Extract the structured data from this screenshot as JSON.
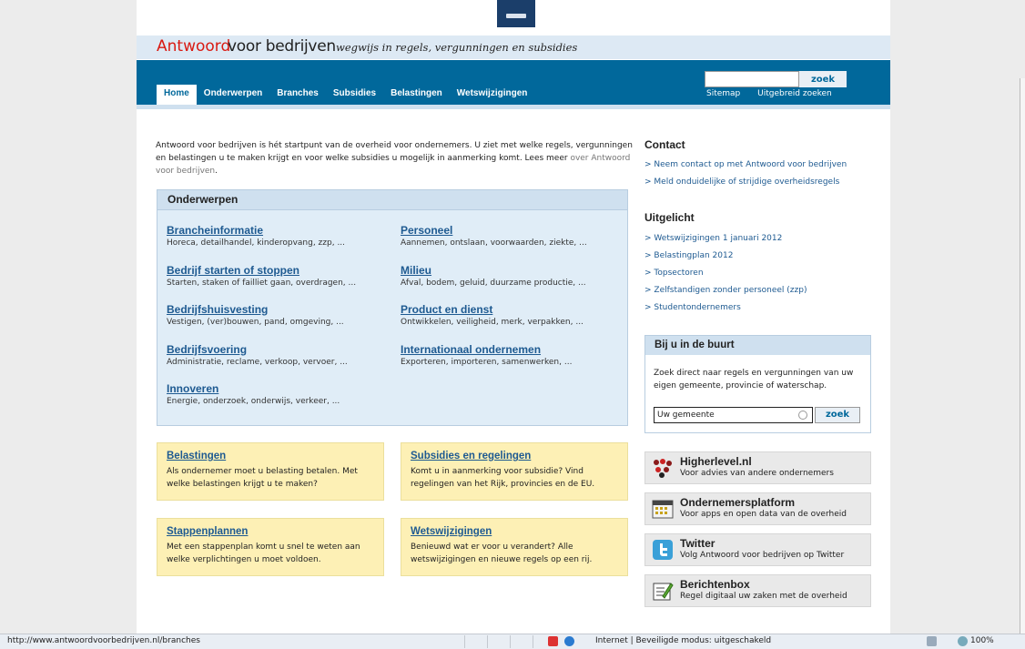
{
  "header": {
    "logo_part1": "Antwoord",
    "logo_part2": "voor bedrijven",
    "tagline": "wegwijs in regels, vergunningen en subsidies"
  },
  "nav": {
    "items": [
      "Home",
      "Onderwerpen",
      "Branches",
      "Subsidies",
      "Belastingen",
      "Wetswijzigingen"
    ],
    "active": "Home"
  },
  "search": {
    "value": "",
    "button": "zoek",
    "links": [
      "Sitemap",
      "Uitgebreid zoeken"
    ]
  },
  "intro": {
    "text": "Antwoord voor bedrijven is hét startpunt van de overheid voor ondernemers. U ziet met welke regels, vergunningen en belastingen u te maken krijgt en voor welke subsidies u mogelijk in aanmerking komt. Lees meer ",
    "link": "over Antwoord voor bedrijven",
    "suffix": "."
  },
  "onderwerpen": {
    "title": "Onderwerpen",
    "left": [
      {
        "title": "Brancheinformatie",
        "sub": "Horeca, detailhandel, kinderopvang, zzp, ..."
      },
      {
        "title": "Bedrijf starten of stoppen",
        "sub": "Starten, staken of failliet gaan, overdragen, ..."
      },
      {
        "title": "Bedrijfshuisvesting",
        "sub": "Vestigen, (ver)bouwen, pand, omgeving, ..."
      },
      {
        "title": "Bedrijfsvoering",
        "sub": "Administratie, reclame, verkoop, vervoer, ..."
      },
      {
        "title": "Innoveren",
        "sub": "Energie, onderzoek, onderwijs, verkeer, ..."
      }
    ],
    "right": [
      {
        "title": "Personeel",
        "sub": "Aannemen, ontslaan, voorwaarden, ziekte, ..."
      },
      {
        "title": "Milieu",
        "sub": "Afval, bodem, geluid, duurzame productie, ..."
      },
      {
        "title": "Product en dienst",
        "sub": "Ontwikkelen, veiligheid, merk, verpakken, ..."
      },
      {
        "title": "Internationaal ondernemen",
        "sub": "Exporteren, importeren, samenwerken, ..."
      }
    ]
  },
  "boxes": [
    {
      "title": "Belastingen",
      "text": "Als ondernemer moet u belasting betalen. Met welke belastingen krijgt u te maken?"
    },
    {
      "title": "Subsidies en regelingen",
      "text": "Komt u in aanmerking voor subsidie? Vind regelingen van het Rijk, provincies en de EU."
    },
    {
      "title": "Stappenplannen",
      "text": "Met een stappenplan komt u snel te weten aan welke verplichtingen u moet voldoen."
    },
    {
      "title": "Wetswijzigingen",
      "text": "Benieuwd wat er voor u verandert? Alle wetswijzigingen en nieuwe regels op een rij."
    }
  ],
  "contact": {
    "title": "Contact",
    "links": [
      "Neem contact op met Antwoord voor bedrijven",
      "Meld onduidelijke of strijdige overheidsregels"
    ]
  },
  "uitgelicht": {
    "title": "Uitgelicht",
    "links": [
      "Wetswijzigingen 1 januari 2012",
      "Belastingplan 2012",
      "Topsectoren",
      "Zelfstandigen zonder personeel (zzp)",
      "Studentondernemers"
    ]
  },
  "buurt": {
    "title": "Bij u in de buurt",
    "text": "Zoek direct naar regels en vergunningen van uw eigen gemeente, provincie of waterschap.",
    "input_value": "Uw gemeente",
    "button": "zoek"
  },
  "tiles": [
    {
      "title": "Higherlevel.nl",
      "sub": "Voor advies van andere ondernemers",
      "icon": "higherlevel-icon"
    },
    {
      "title": "Ondernemersplatform",
      "sub": "Voor apps en open data van de overheid",
      "icon": "calendar-icon"
    },
    {
      "title": "Twitter",
      "sub": "Volg Antwoord voor bedrijven op Twitter",
      "icon": "twitter-icon"
    },
    {
      "title": "Berichtenbox",
      "sub": "Regel digitaal uw zaken met de overheid",
      "icon": "notepad-icon"
    }
  ],
  "statusbar": {
    "url": "http://www.antwoordvoorbedrijven.nl/branches",
    "zone": "Internet | Beveiligde modus: uitgeschakeld",
    "zoom": "100%"
  },
  "colors": {
    "brand_blue": "#01689b",
    "link_blue": "#1e5a91",
    "logo_red": "#d91a12",
    "yellow_box": "#fdf0b5"
  }
}
